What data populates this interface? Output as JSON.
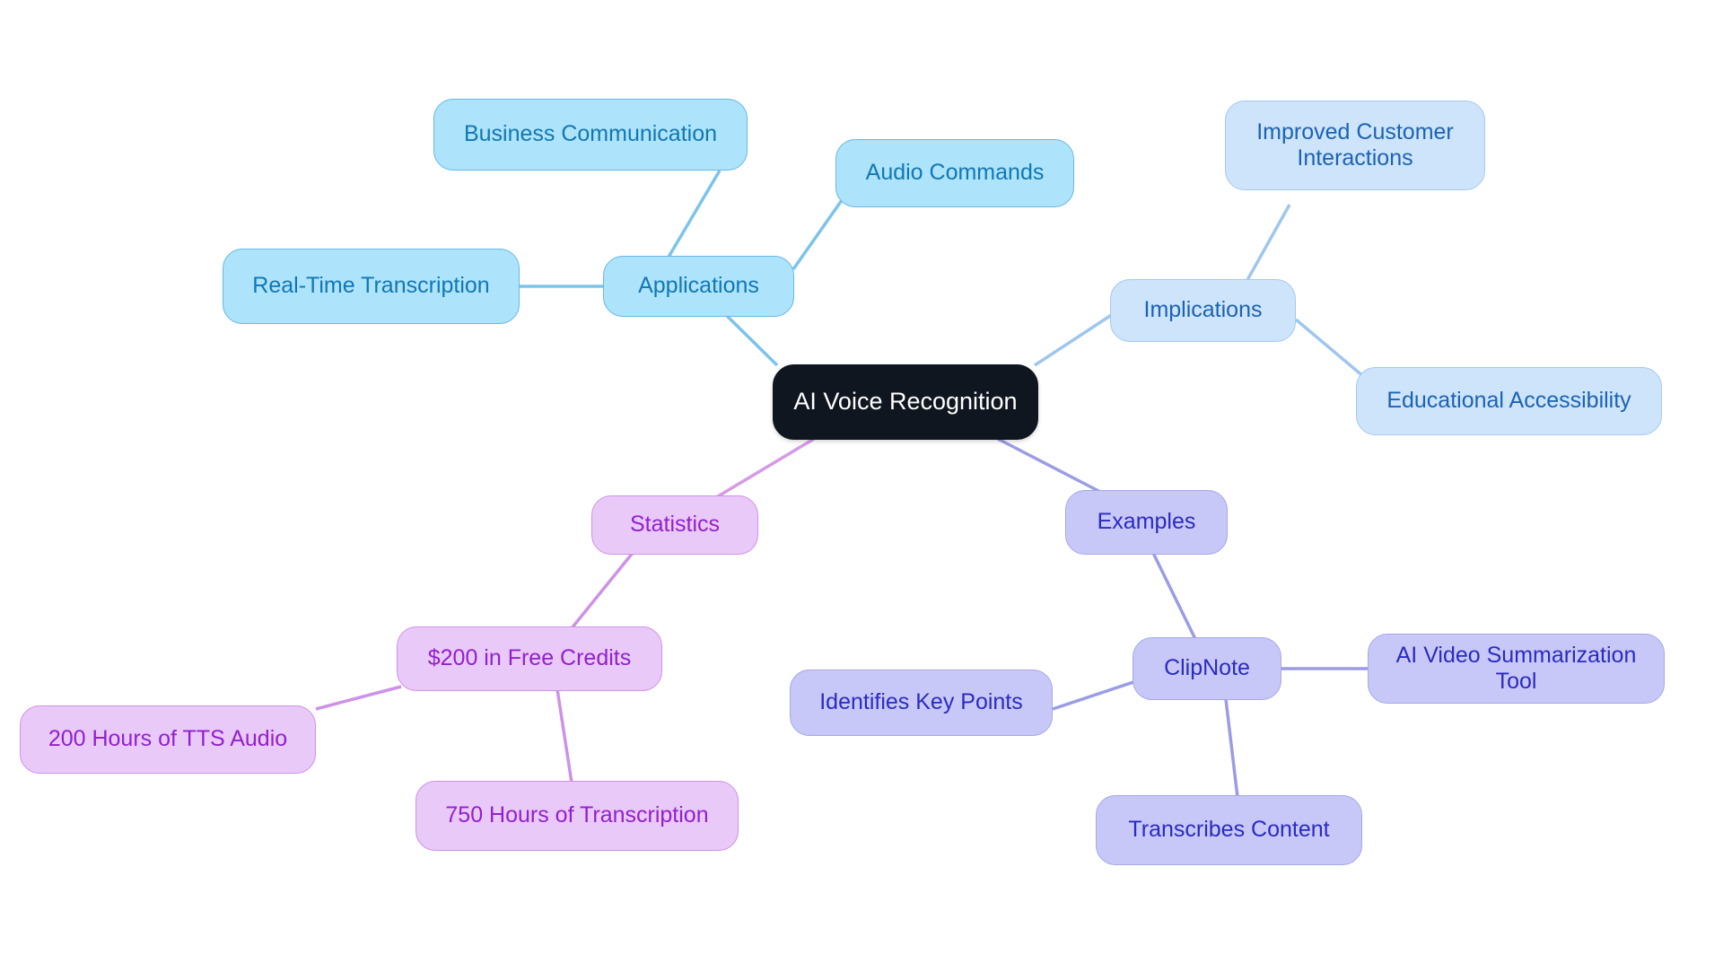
{
  "diagram": {
    "type": "mindmap",
    "title": "AI Voice Recognition",
    "background": "#ffffff",
    "root": {
      "id": "root",
      "label": "AI Voice Recognition",
      "fill": "#10161f",
      "text_color": "#ffffff"
    },
    "branches": [
      {
        "id": "applications",
        "label": "Applications",
        "fill": "#ade3fb",
        "stroke": "#67b7e8",
        "text_color": "#1178b4",
        "children": [
          {
            "id": "business-communication",
            "label": "Business Communication"
          },
          {
            "id": "audio-commands",
            "label": "Audio Commands"
          },
          {
            "id": "real-time-transcription",
            "label": "Real-Time Transcription"
          }
        ]
      },
      {
        "id": "implications",
        "label": "Implications",
        "fill": "#cde4fb",
        "stroke": "#a6c9ef",
        "text_color": "#1b63b5",
        "children": [
          {
            "id": "improved-customer-interactions",
            "label": "Improved Customer\nInteractions"
          },
          {
            "id": "educational-accessibility",
            "label": "Educational Accessibility"
          }
        ]
      },
      {
        "id": "examples",
        "label": "Examples",
        "fill": "#c7c8f8",
        "stroke": "#a6a7e8",
        "text_color": "#2b2bc0",
        "children": [
          {
            "id": "clipnote",
            "label": "ClipNote",
            "children": [
              {
                "id": "ai-video-summarization-tool",
                "label": "AI Video Summarization Tool"
              },
              {
                "id": "identifies-key-points",
                "label": "Identifies Key Points"
              },
              {
                "id": "transcribes-content",
                "label": "Transcribes Content"
              }
            ]
          }
        ]
      },
      {
        "id": "statistics",
        "label": "Statistics",
        "fill": "#e9c9f8",
        "stroke": "#cd92e8",
        "text_color": "#9320cf",
        "children": [
          {
            "id": "free-credits",
            "label": "$200 in Free Credits",
            "children": [
              {
                "id": "tts-audio-hours",
                "label": "200 Hours of TTS Audio"
              },
              {
                "id": "transcription-hours",
                "label": "750 Hours of Transcription"
              }
            ]
          }
        ]
      }
    ],
    "nodes": {
      "root": "AI Voice Recognition",
      "applications": "Applications",
      "business_communication": "Business Communication",
      "audio_commands": "Audio Commands",
      "real_time_transcription": "Real-Time Transcription",
      "implications": "Implications",
      "improved_customer_interactions": "Improved Customer\nInteractions",
      "educational_accessibility": "Educational Accessibility",
      "examples": "Examples",
      "clipnote": "ClipNote",
      "ai_video_summarization_tool": "AI Video Summarization Tool",
      "identifies_key_points": "Identifies Key Points",
      "transcribes_content": "Transcribes Content",
      "statistics": "Statistics",
      "free_credits": "$200 in Free Credits",
      "tts_audio_hours": "200 Hours of TTS Audio",
      "transcription_hours": "750 Hours of Transcription"
    }
  }
}
